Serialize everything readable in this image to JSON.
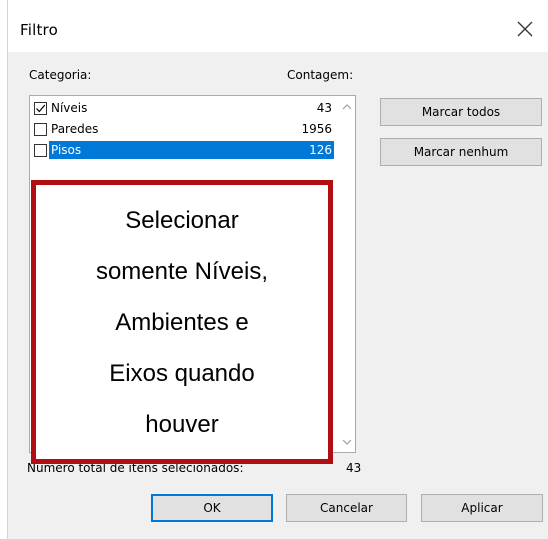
{
  "dialog": {
    "title": "Filtro",
    "close_glyph": "✕"
  },
  "labels": {
    "category": "Categoria:",
    "count": "Contagem:",
    "total_selected": "Número total de itens selecionados:",
    "total_value": "43"
  },
  "list": {
    "items": [
      {
        "name": "Níveis",
        "count": "43",
        "checked": true,
        "selected": false
      },
      {
        "name": "Paredes",
        "count": "1956",
        "checked": false,
        "selected": false
      },
      {
        "name": "Pisos",
        "count": "126",
        "checked": false,
        "selected": true
      }
    ]
  },
  "buttons": {
    "check_all": "Marcar todos",
    "check_none": "Marcar nenhum",
    "ok": "OK",
    "cancel": "Cancelar",
    "apply": "Aplicar"
  },
  "annotation": {
    "lines": [
      "Selecionar",
      "somente Níveis,",
      "Ambientes e",
      "Eixos quando",
      "houver"
    ],
    "border_color": "#b00e12"
  },
  "colors": {
    "selection": "#0078d7",
    "dialog_bg": "#f0f0f0"
  },
  "icons": {
    "close": "close-icon",
    "scroll_up": "chevron-up-icon",
    "scroll_down": "chevron-down-icon",
    "checkbox": "checkmark-icon"
  }
}
